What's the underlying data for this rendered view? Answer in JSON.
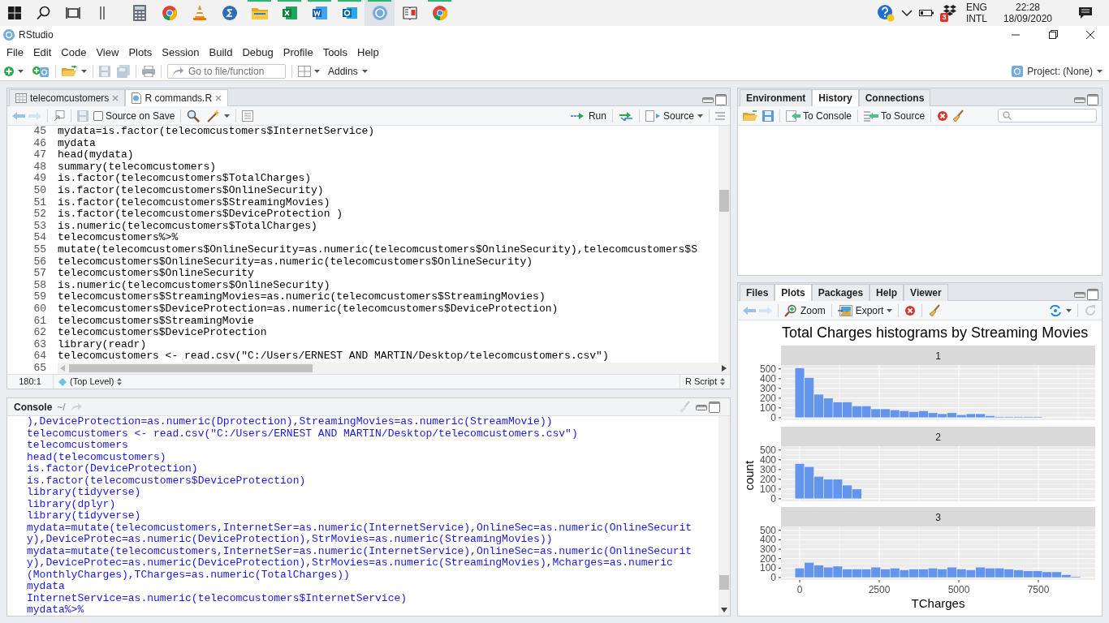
{
  "taskbar": {
    "start_items": [
      {
        "kind": "windows"
      },
      {
        "kind": "search"
      },
      {
        "kind": "task-view"
      },
      {
        "kind": "handle"
      }
    ],
    "apps": [
      {
        "kind": "calculator",
        "running": false,
        "selected": false
      },
      {
        "kind": "browser",
        "running": false,
        "selected": false
      },
      {
        "kind": "cone",
        "running": false,
        "selected": false
      },
      {
        "kind": "sigma",
        "running": false,
        "selected": false
      },
      {
        "kind": "folder",
        "running": true,
        "selected": false
      },
      {
        "kind": "sheet",
        "running": true,
        "selected": false
      },
      {
        "kind": "doc",
        "running": true,
        "selected": false
      },
      {
        "kind": "mail",
        "running": true,
        "selected": false
      },
      {
        "kind": "rlogo",
        "running": true,
        "selected": true
      },
      {
        "kind": "book",
        "running": false,
        "selected": false
      },
      {
        "kind": "browser",
        "running": true,
        "selected": false
      }
    ],
    "tray": {
      "badge": "3",
      "language": "ENG",
      "layout": "INTL",
      "time": "22:28",
      "date": "18/09/2020"
    }
  },
  "window": {
    "title": "RStudio"
  },
  "menu": [
    "File",
    "Edit",
    "Code",
    "View",
    "Plots",
    "Session",
    "Build",
    "Debug",
    "Profile",
    "Tools",
    "Help"
  ],
  "toolbar": {
    "goto_placeholder": "Go to file/function",
    "addins": "Addins",
    "project": "Project: (None)"
  },
  "editor": {
    "tabs": [
      {
        "label": "telecomcustomers",
        "kind": "data",
        "selected": false
      },
      {
        "label": "R commands.R",
        "kind": "script",
        "selected": true
      }
    ],
    "source_on_save": {
      "label": "Source on Save",
      "checked": false
    },
    "run": "Run",
    "source": "Source",
    "lines": [
      {
        "number": "45",
        "code": "mydata=is.factor(telecomcustomers$InternetService)"
      },
      {
        "number": "46",
        "code": "mydata"
      },
      {
        "number": "47",
        "code": "head(mydata)"
      },
      {
        "number": "48",
        "code": "summary(telecomcustomers)"
      },
      {
        "number": "49",
        "code": "is.factor(telecomcustomers$TotalCharges)"
      },
      {
        "number": "50",
        "code": "is.factor(telecomcustomers$OnlineSecurity)"
      },
      {
        "number": "51",
        "code": "is.factor(telecomcustomers$StreamingMovies)"
      },
      {
        "number": "52",
        "code": "is.factor(telecomcustomers$DeviceProtection )"
      },
      {
        "number": "53",
        "code": "is.numeric(telecomcustomers$TotalCharges)"
      },
      {
        "number": "54",
        "code": "telecomcustomers%>%"
      },
      {
        "number": "55",
        "code": "mutate(telecomcustomers$OnlineSecurity=as.numeric(telecomcustomers$OnlineSecurity),telecomcustomers$S"
      },
      {
        "number": "56",
        "code": "telecomcustomers$OnlineSecurity=as.numeric(telecomcustomers$OnlineSecurity)"
      },
      {
        "number": "57",
        "code": "telecomcustomers$OnlineSecurity"
      },
      {
        "number": "58",
        "code": "is.numeric(telecomcustomers$OnlineSecurity)"
      },
      {
        "number": "59",
        "code": "telecomcustomers$StreamingMovies=as.numeric(telecomcustomers$StreamingMovies)"
      },
      {
        "number": "60",
        "code": "telecomcustomers$DeviceProtection=as.numeric(telecomcustomers$DeviceProtection)"
      },
      {
        "number": "61",
        "code": "telecomcustomers$StreamingMovie"
      },
      {
        "number": "62",
        "code": "telecomcustomers$DeviceProtection"
      },
      {
        "number": "63",
        "code": "library(readr)"
      },
      {
        "number": "64",
        "code": "telecomcustomers <- read.csv(\"C:/Users/ERNEST AND MARTIN/Desktop/telecomcustomers.csv\")"
      },
      {
        "number": "65"
      }
    ],
    "status": {
      "position": "180:1",
      "scope": "(Top Level)",
      "file_type": "R Script"
    }
  },
  "console": {
    "title": "Console",
    "path": "~/",
    "lines": [
      "),DeviceProtection=as.numeric(Dprotection),StreamingMovies=as.numeric(StreamMovie))",
      "telecomcustomers <- read.csv(\"C:/Users/ERNEST AND MARTIN/Desktop/telecomcustomers.csv\")",
      "telecomcustomers",
      "head(telecomcustomers)",
      "is.factor(DeviceProtection)",
      "is.factor(telecomcustomers$DeviceProtection)",
      "library(tidyverse)",
      "library(dplyr)",
      "library(tidyverse)",
      "mydata=mutate(telecomcustomers,InternetSer=as.numeric(InternetService),OnlineSec=as.numeric(OnlineSecurit",
      "y),DeviceProtec=as.numeric(DeviceProtection),StrMovies=as.numeric(StreamingMovies))",
      "mydata=mutate(telecomcustomers,InternetSer=as.numeric(InternetService),OnlineSec=as.numeric(OnlineSecurit",
      "y),DeviceProtec=as.numeric(DeviceProtection),StrMovies=as.numeric(StreamingMovies),Mcharges=as.numeric",
      "(MonthlyCharges),TCharges=as.numeric(TotalCharges))",
      "mydata",
      "InternetService=as.numeric(telecomcustomers$InternetService)",
      "mydata%>%"
    ]
  },
  "history_pane": {
    "tabs": [
      {
        "label": "Environment",
        "selected": false
      },
      {
        "label": "History",
        "selected": true
      },
      {
        "label": "Connections",
        "selected": false
      }
    ],
    "to_console": "To Console",
    "to_source": "To Source"
  },
  "plots_pane": {
    "tabs": [
      {
        "label": "Files",
        "selected": false
      },
      {
        "label": "Plots",
        "selected": true
      },
      {
        "label": "Packages",
        "selected": false
      },
      {
        "label": "Help",
        "selected": false
      },
      {
        "label": "Viewer",
        "selected": false
      }
    ],
    "zoom": "Zoom",
    "export": "Export",
    "plot": {
      "title": "Total Charges histograms by Streaming Movies",
      "ylabel": "count",
      "facets": [
        {
          "label": "1",
          "chart_data": {
            "type": "bar",
            "grid": true,
            "x": [
              0,
              299,
              598,
              897,
              1196,
              1495,
              1794,
              2093,
              2392,
              2691,
              2990,
              3289,
              3588,
              3887,
              4186,
              4485,
              4784,
              5083,
              5382,
              5681,
              5980,
              6279,
              6578,
              6877,
              7176,
              7475
            ],
            "values": [
              510,
              410,
              240,
              200,
              160,
              160,
              120,
              120,
              90,
              90,
              80,
              70,
              60,
              70,
              50,
              40,
              50,
              30,
              40,
              40,
              20,
              10,
              10,
              10,
              10,
              10
            ],
            "xlim": [
              -587,
              9286
            ],
            "ylim": [
              -26,
              540
            ],
            "yticks": [
              0,
              100,
              200,
              300,
              400,
              500
            ]
          }
        },
        {
          "label": "2",
          "chart_data": {
            "type": "bar",
            "grid": true,
            "x": [
              0,
              299,
              598,
              897,
              1196,
              1495,
              1794
            ],
            "values": [
              360,
              330,
              230,
              200,
              200,
              140,
              100
            ],
            "xlim": [
              -587,
              9286
            ],
            "ylim": [
              -26,
              540
            ],
            "yticks": [
              0,
              100,
              200,
              300,
              400,
              500
            ]
          }
        },
        {
          "label": "3",
          "chart_data": {
            "type": "bar",
            "grid": true,
            "xlabel": "TCharges",
            "x": [
              0,
              299,
              598,
              897,
              1196,
              1495,
              1794,
              2093,
              2392,
              2691,
              2990,
              3289,
              3588,
              3887,
              4186,
              4485,
              4784,
              5083,
              5382,
              5681,
              5980,
              6279,
              6578,
              6877,
              7176,
              7475,
              7774,
              8073,
              8372,
              8671
            ],
            "values": [
              100,
              160,
              130,
              110,
              120,
              90,
              90,
              90,
              110,
              90,
              100,
              80,
              90,
              90,
              100,
              90,
              110,
              90,
              80,
              110,
              100,
              100,
              90,
              80,
              70,
              70,
              60,
              60,
              30,
              10
            ],
            "xlim": [
              -587,
              9286
            ],
            "ylim": [
              -26,
              540
            ],
            "xticks": [
              0,
              2500,
              5000,
              7500
            ],
            "yticks": [
              0,
              100,
              200,
              300,
              400,
              500
            ]
          }
        }
      ]
    }
  }
}
